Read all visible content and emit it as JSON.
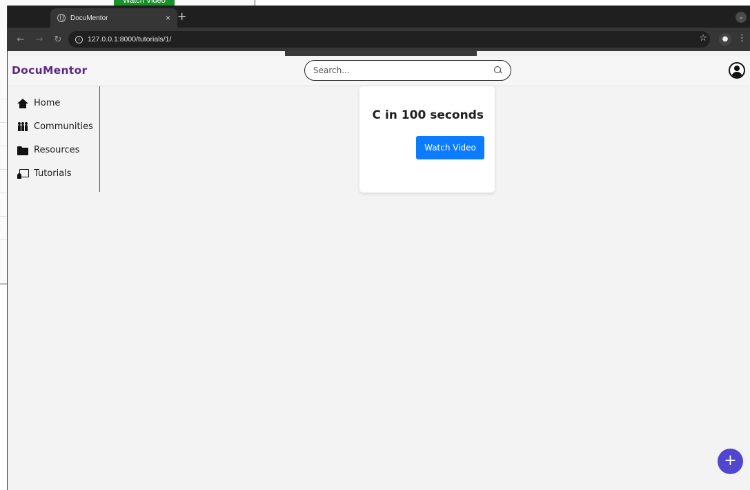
{
  "background_window": {
    "watch_label": "Watch Video"
  },
  "browser": {
    "tab_title": "DocuMentor",
    "tab_close": "×",
    "new_tab": "+",
    "url": "127.0.0.1:8000/tutorials/1/"
  },
  "header": {
    "brand": "DocuMentor",
    "search_placeholder": "Search..."
  },
  "sidebar": {
    "items": [
      {
        "label": "Home",
        "icon": "home-icon"
      },
      {
        "label": "Communities",
        "icon": "communities-icon"
      },
      {
        "label": "Resources",
        "icon": "folder-icon"
      },
      {
        "label": "Tutorials",
        "icon": "tutorials-icon"
      }
    ]
  },
  "card": {
    "title": "C in 100 seconds",
    "button_label": "Watch Video"
  },
  "fab": {
    "label": "+"
  },
  "colors": {
    "brand": "#5b2a86",
    "primary_button": "#0b7cff",
    "fab": "#5046cf",
    "background_watch_button": "#1a8f2a"
  }
}
